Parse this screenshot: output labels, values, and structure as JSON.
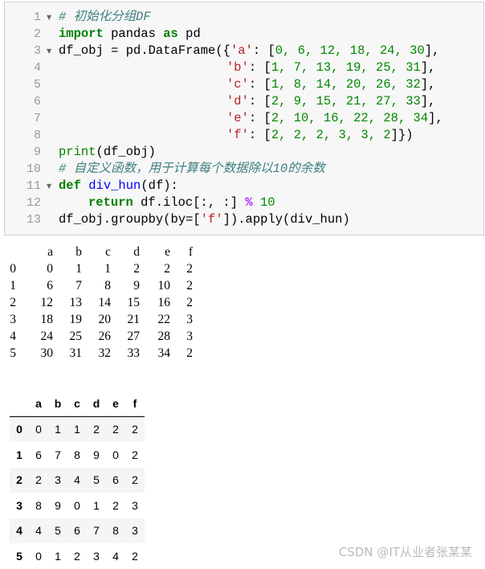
{
  "code": {
    "lines": [
      {
        "n": "1",
        "fold": true
      },
      {
        "n": "2",
        "fold": false
      },
      {
        "n": "3",
        "fold": true
      },
      {
        "n": "4",
        "fold": false
      },
      {
        "n": "5",
        "fold": false
      },
      {
        "n": "6",
        "fold": false
      },
      {
        "n": "7",
        "fold": false
      },
      {
        "n": "8",
        "fold": false
      },
      {
        "n": "9",
        "fold": false
      },
      {
        "n": "10",
        "fold": false
      },
      {
        "n": "11",
        "fold": true
      },
      {
        "n": "12",
        "fold": false
      },
      {
        "n": "13",
        "fold": false
      }
    ],
    "l1": "# 初始化分组DF",
    "l2_kw1": "import",
    "l2_mid": " pandas ",
    "l2_kw2": "as",
    "l2_end": " pd",
    "l3a": "df_obj = pd.DataFrame({",
    "l3s": "'a'",
    "l3b": ": [",
    "l3v": "0, 6, 12, 18, 24, 30",
    "l3c": "],",
    "l4s": "'b'",
    "l4v": "1, 7, 13, 19, 25, 31",
    "l5s": "'c'",
    "l5v": "1, 8, 14, 20, 26, 32",
    "l6s": "'d'",
    "l6v": "2, 9, 15, 21, 27, 33",
    "l7s": "'e'",
    "l7v": "2, 10, 16, 22, 28, 34",
    "l8s": "'f'",
    "l8v": "2, 2, 2, 3, 3, 2",
    "l8c": "]})",
    "l9a": "print",
    "l9b": "(df_obj)",
    "l10": "# 自定义函数，用于计算每个数据除以10的余数",
    "l11kw": "def",
    "l11fn": "div_hun",
    "l11b": "(df):",
    "l12kw": "return",
    "l12a": " df.iloc[:, :] ",
    "l12op": "%",
    "l12n": "10",
    "l13a": "df_obj.groupby(by=[",
    "l13s": "'f'",
    "l13b": "]).apply(div_hun)"
  },
  "print_output": {
    "columns": [
      "a",
      "b",
      "c",
      "d",
      "e",
      "f"
    ],
    "rows": [
      {
        "idx": "0",
        "v": [
          "0",
          "1",
          "1",
          "2",
          "2",
          "2"
        ]
      },
      {
        "idx": "1",
        "v": [
          "6",
          "7",
          "8",
          "9",
          "10",
          "2"
        ]
      },
      {
        "idx": "2",
        "v": [
          "12",
          "13",
          "14",
          "15",
          "16",
          "2"
        ]
      },
      {
        "idx": "3",
        "v": [
          "18",
          "19",
          "20",
          "21",
          "22",
          "3"
        ]
      },
      {
        "idx": "4",
        "v": [
          "24",
          "25",
          "26",
          "27",
          "28",
          "3"
        ]
      },
      {
        "idx": "5",
        "v": [
          "30",
          "31",
          "32",
          "33",
          "34",
          "2"
        ]
      }
    ]
  },
  "result_table": {
    "columns": [
      "a",
      "b",
      "c",
      "d",
      "e",
      "f"
    ],
    "rows": [
      {
        "idx": "0",
        "v": [
          "0",
          "1",
          "1",
          "2",
          "2",
          "2"
        ]
      },
      {
        "idx": "1",
        "v": [
          "6",
          "7",
          "8",
          "9",
          "0",
          "2"
        ]
      },
      {
        "idx": "2",
        "v": [
          "2",
          "3",
          "4",
          "5",
          "6",
          "2"
        ]
      },
      {
        "idx": "3",
        "v": [
          "8",
          "9",
          "0",
          "1",
          "2",
          "3"
        ]
      },
      {
        "idx": "4",
        "v": [
          "4",
          "5",
          "6",
          "7",
          "8",
          "3"
        ]
      },
      {
        "idx": "5",
        "v": [
          "0",
          "1",
          "2",
          "3",
          "4",
          "2"
        ]
      }
    ]
  },
  "watermark": "CSDN @IT从业者张某某"
}
